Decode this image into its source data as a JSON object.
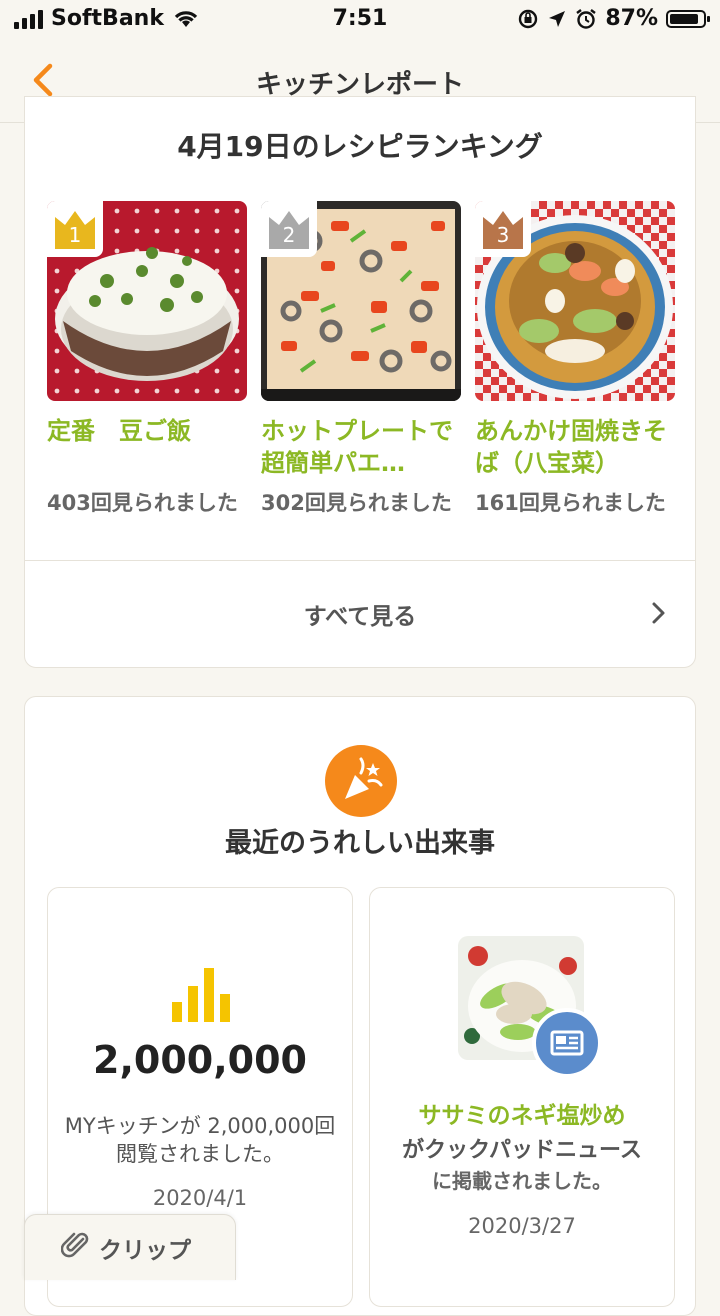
{
  "status_bar": {
    "carrier": "SoftBank",
    "time": "7:51",
    "battery": "87%",
    "battery_level": 0.87
  },
  "nav": {
    "title": "キッチンレポート",
    "back_icon": "chevron-left-icon"
  },
  "ranking": {
    "heading": "4月19日のレシピランキング",
    "items": [
      {
        "rank": "1",
        "title": "定番　豆ご飯",
        "views": "403回見られました",
        "crown_color": "#e8b71e"
      },
      {
        "rank": "2",
        "title": "ホットプレートで超簡単パエ…",
        "views": "302回見られました",
        "crown_color": "#a9a9a9"
      },
      {
        "rank": "3",
        "title": "あんかけ固焼きそば（八宝菜）",
        "views": "161回見られました",
        "crown_color": "#b8754a"
      }
    ],
    "see_all": "すべて見る"
  },
  "events": {
    "heading": "最近のうれしい出来事",
    "icon": "party-popper-icon",
    "cards": [
      {
        "type": "views",
        "icon": "bar-chart-icon",
        "number": "2,000,000",
        "desc": "MYキッチンが 2,000,000回閲覧されました。",
        "date": "2020/4/1"
      },
      {
        "type": "news",
        "icon": "newspaper-icon",
        "recipe": "ササミのネギ塩炒め",
        "desc": "がクックパッドニュース",
        "desc2": "に掲載されました。",
        "date": "2020/3/27"
      }
    ]
  },
  "clip_tab": {
    "label": "クリップ",
    "icon": "paperclip-icon"
  },
  "colors": {
    "accent_orange": "#f5891b",
    "recipe_green": "#8cb824",
    "news_blue": "#5b8ccc",
    "chart_yellow": "#f5c400"
  }
}
